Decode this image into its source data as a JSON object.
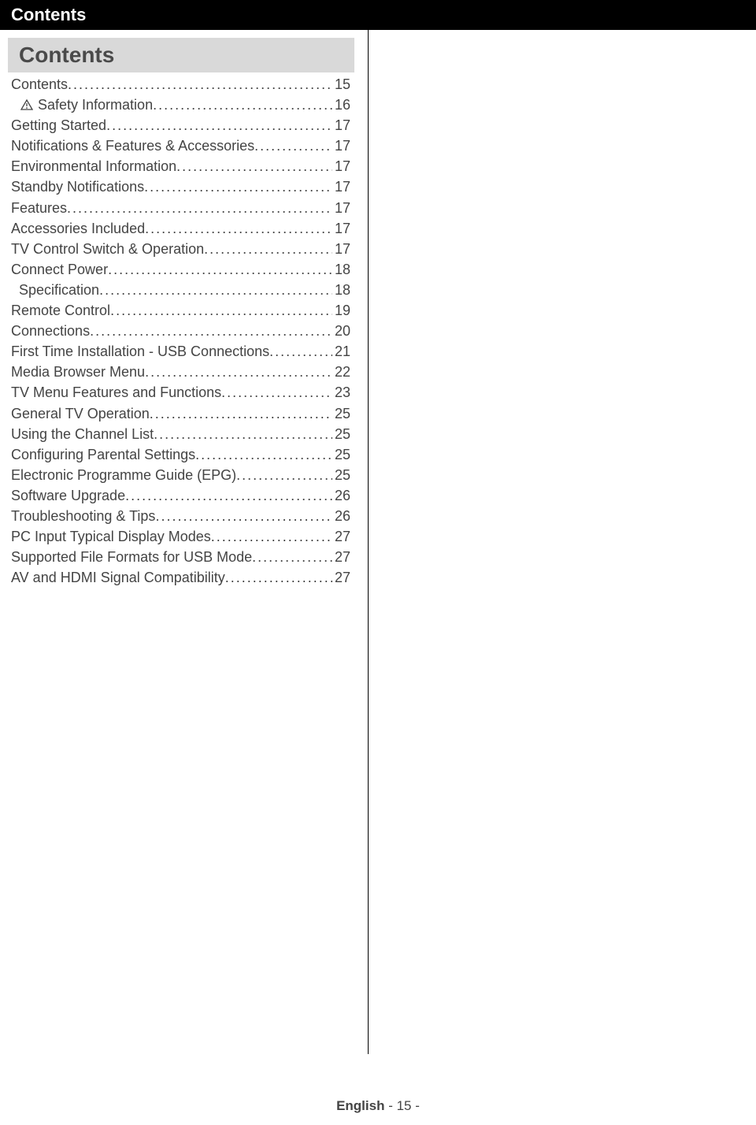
{
  "header": {
    "title": "Contents"
  },
  "section_heading": "Contents",
  "toc": {
    "items": [
      {
        "title": "Contents",
        "page": "15",
        "icon": "",
        "indent": false
      },
      {
        "title": "Safety Information",
        "page": "16",
        "icon": "warning",
        "indent": true
      },
      {
        "title": "Getting Started",
        "page": "17",
        "icon": "",
        "indent": false
      },
      {
        "title": "Notifications & Features & Accessories",
        "page": "17",
        "icon": "",
        "indent": false
      },
      {
        "title": "Environmental Information",
        "page": "17",
        "icon": "",
        "indent": false
      },
      {
        "title": "Standby Notifications",
        "page": "17",
        "icon": "",
        "indent": false
      },
      {
        "title": "Features",
        "page": "17",
        "icon": "",
        "indent": false
      },
      {
        "title": "Accessories Included",
        "page": "17",
        "icon": "",
        "indent": false
      },
      {
        "title": "TV Control Switch & Operation",
        "page": "17",
        "icon": "",
        "indent": false
      },
      {
        "title": "Connect Power",
        "page": "18",
        "icon": "",
        "indent": false
      },
      {
        "title": "Specification",
        "page": "18",
        "icon": "",
        "indent": true
      },
      {
        "title": "Remote Control",
        "page": "19",
        "icon": "",
        "indent": false
      },
      {
        "title": "Connections",
        "page": "20",
        "icon": "",
        "indent": false
      },
      {
        "title": "First Time Installation - USB Connections",
        "page": "21",
        "icon": "",
        "indent": false
      },
      {
        "title": "Media Browser Menu",
        "page": "22",
        "icon": "",
        "indent": false
      },
      {
        "title": "TV Menu Features and Functions",
        "page": "23",
        "icon": "",
        "indent": false
      },
      {
        "title": "General TV Operation",
        "page": "25",
        "icon": "",
        "indent": false
      },
      {
        "title": "Using the Channel List",
        "page": "25",
        "icon": "",
        "indent": false
      },
      {
        "title": "Configuring Parental Settings",
        "page": "25",
        "icon": "",
        "indent": false
      },
      {
        "title": "Electronic Programme Guide (EPG)",
        "page": "25",
        "icon": "",
        "indent": false
      },
      {
        "title": "Software Upgrade",
        "page": "26",
        "icon": "",
        "indent": false
      },
      {
        "title": "Troubleshooting & Tips",
        "page": "26",
        "icon": "",
        "indent": false
      },
      {
        "title": "PC Input Typical Display Modes",
        "page": "27",
        "icon": "",
        "indent": false
      },
      {
        "title": "Supported File Formats for USB Mode",
        "page": "27",
        "icon": "",
        "indent": false
      },
      {
        "title": "AV and HDMI Signal Compatibility",
        "page": "27",
        "icon": "",
        "indent": false
      }
    ]
  },
  "footer": {
    "language": "English",
    "separator": "   - ",
    "page_number": "15",
    "suffix": " -"
  }
}
